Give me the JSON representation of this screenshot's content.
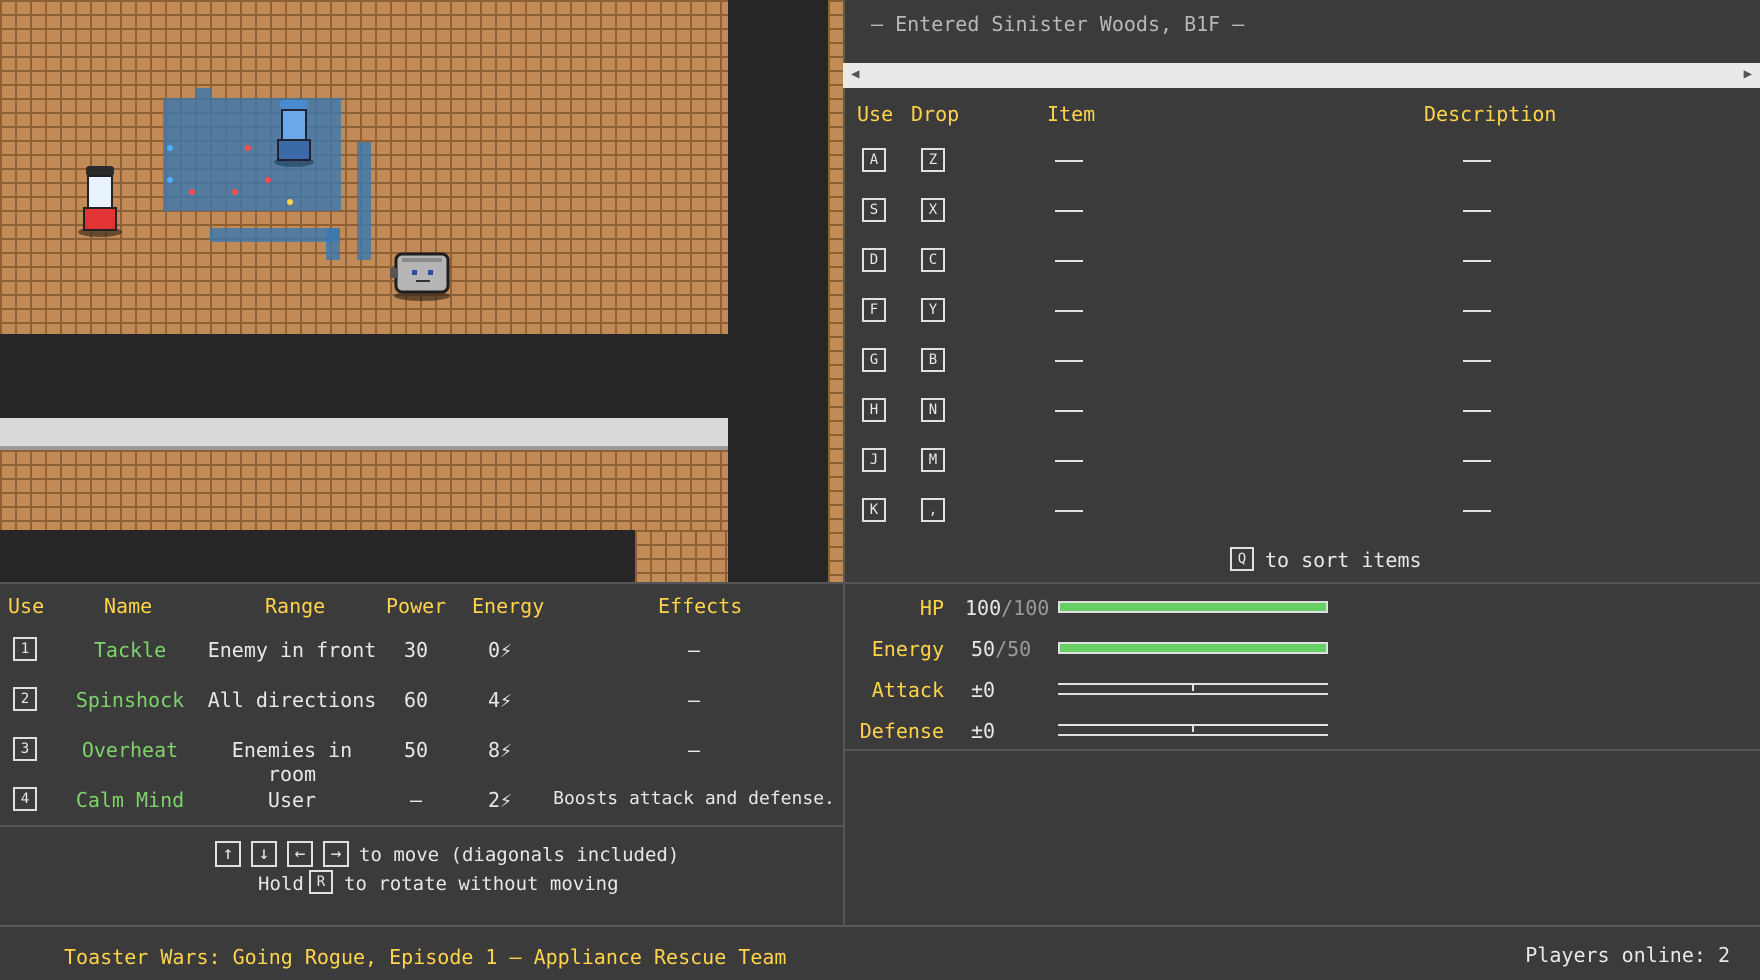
{
  "log": {
    "message": "— Entered Sinister Woods, B1F —"
  },
  "inventory": {
    "headers": {
      "use": "Use",
      "drop": "Drop",
      "item": "Item",
      "description": "Description"
    },
    "rows": [
      {
        "use_key": "A",
        "drop_key": "Z"
      },
      {
        "use_key": "S",
        "drop_key": "X"
      },
      {
        "use_key": "D",
        "drop_key": "C"
      },
      {
        "use_key": "F",
        "drop_key": "Y"
      },
      {
        "use_key": "G",
        "drop_key": "B"
      },
      {
        "use_key": "H",
        "drop_key": "N"
      },
      {
        "use_key": "J",
        "drop_key": "M"
      },
      {
        "use_key": "K",
        "drop_key": ","
      }
    ],
    "sort_key": "Q",
    "sort_text": "to sort items"
  },
  "stats": {
    "hp": {
      "label": "HP",
      "value": "100",
      "max": "/100",
      "fill": 1.0
    },
    "energy": {
      "label": "Energy",
      "value": "50",
      "max": "/50",
      "fill": 1.0
    },
    "attack": {
      "label": "Attack",
      "value": "±0",
      "level": 0.5
    },
    "defense": {
      "label": "Defense",
      "value": "±0",
      "level": 0.5
    }
  },
  "moves": {
    "headers": {
      "use": "Use",
      "name": "Name",
      "range": "Range",
      "power": "Power",
      "energy": "Energy",
      "effects": "Effects"
    },
    "rows": [
      {
        "key": "1",
        "name": "Tackle",
        "range": "Enemy in front",
        "power": "30",
        "energy": "0⚡",
        "effects": "—"
      },
      {
        "key": "2",
        "name": "Spinshock",
        "range": "All directions",
        "power": "60",
        "energy": "4⚡",
        "effects": "—"
      },
      {
        "key": "3",
        "name": "Overheat",
        "range": "Enemies in room",
        "power": "50",
        "energy": "8⚡",
        "effects": "—"
      },
      {
        "key": "4",
        "name": "Calm Mind",
        "range": "User",
        "power": "—",
        "energy": "2⚡",
        "effects": "Boosts attack and defense."
      }
    ]
  },
  "help": {
    "arrows": [
      "↑",
      "↓",
      "←",
      "→"
    ],
    "move_text": "to move (diagonals included)",
    "hold_text": "Hold",
    "rotate_key": "R",
    "rotate_text": "to rotate without moving"
  },
  "footer": {
    "title": "Toaster Wars: Going Rogue, Episode 1 — Appliance Rescue Team",
    "players": "Players online: 2"
  },
  "colors": {
    "accent": "#ffd34a",
    "move_name": "#7ed36b",
    "bar": "#65d065",
    "background": "#3b3b3b"
  }
}
